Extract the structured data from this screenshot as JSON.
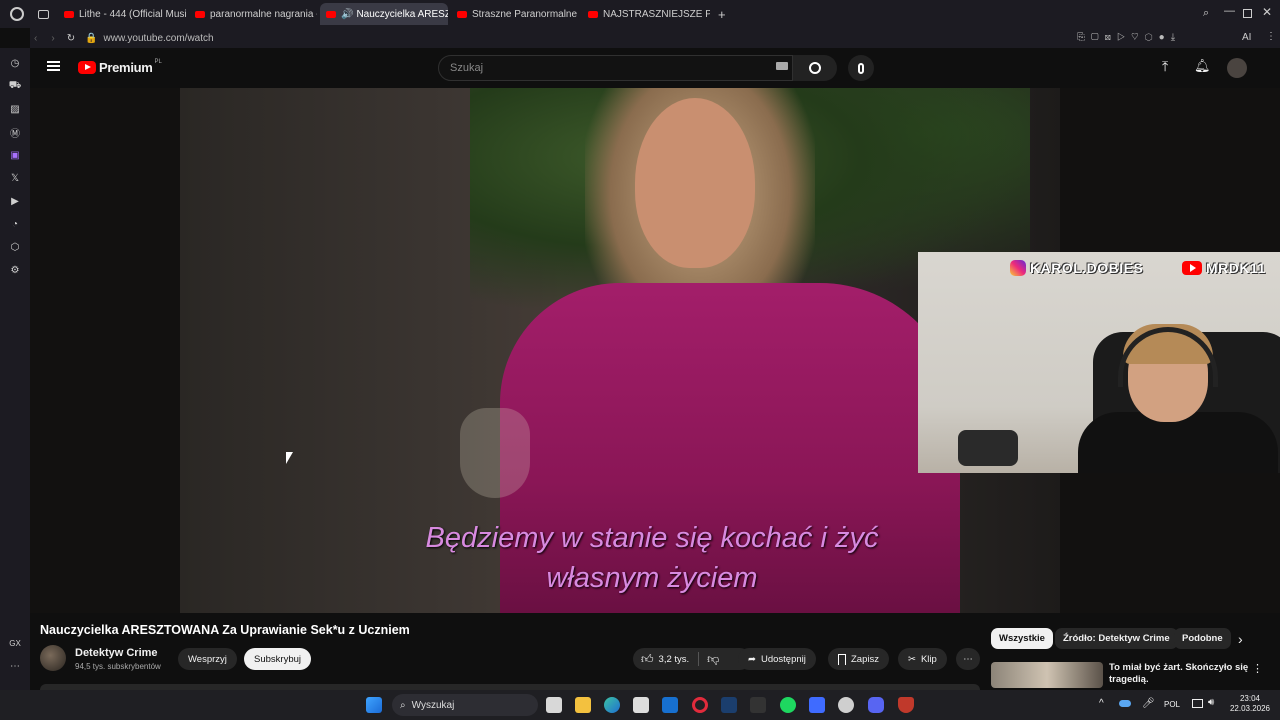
{
  "browser": {
    "tabs": [
      {
        "label": "Lithe - 444 (Official Music",
        "active": false
      },
      {
        "label": "paranormalne nagrania - Y",
        "active": false
      },
      {
        "label": "Nauczycielka ARESZTO",
        "active": true
      },
      {
        "label": "Straszne Paranormalne N",
        "active": false
      },
      {
        "label": "NAJSTRASZNIEJSZE Para",
        "active": false
      }
    ],
    "url": "www.youtube.com/watch",
    "ai_label": "AI"
  },
  "youtube": {
    "logo_text": "Premium",
    "logo_region": "PL",
    "search_placeholder": "Szukaj"
  },
  "video": {
    "subtitle_line1": "Będziemy w stanie się kochać i żyć",
    "subtitle_line2": "własnym życiem",
    "overlay_instagram": "KAROL.DOBIES",
    "overlay_youtube": "MRDK11"
  },
  "meta": {
    "title": "Nauczycielka ARESZTOWANA Za Uprawianie Sek*u z Uczniem",
    "channel": "Detektyw Crime",
    "subscribers": "94,5 tys. subskrybentów",
    "support_label": "Wesprzyj",
    "subscribe_label": "Subskrybuj",
    "likes": "3,2 tys.",
    "share_label": "Udostępnij",
    "save_label": "Zapisz",
    "clip_label": "Klip"
  },
  "related": {
    "chips": [
      "Wszystkie",
      "Źródło: Detektyw Crime",
      "Podobne"
    ],
    "item_title": "To miał być żart. Skończyło się tragedią."
  },
  "taskbar": {
    "search_label": "Wyszukaj",
    "language": "POL",
    "time": "23:04",
    "date": "22.03.2026"
  },
  "colors": {
    "accent": "#ff0000",
    "subtitle": "#d88ae0"
  }
}
